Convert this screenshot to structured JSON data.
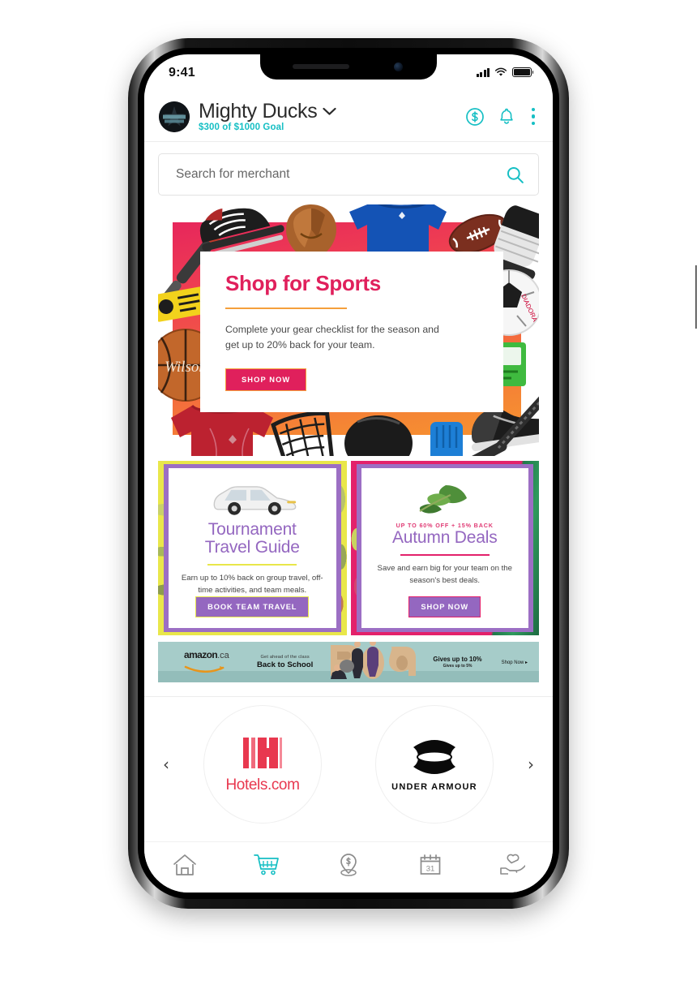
{
  "status_bar": {
    "time": "9:41",
    "signal_icon": "cellular-signal-icon",
    "wifi_icon": "wifi-icon",
    "battery_icon": "battery-icon"
  },
  "header": {
    "avatar_name": "team-logo-avatar",
    "team_name": "Mighty Ducks",
    "dropdown_icon": "chevron-down-icon",
    "goal_text": "$300 of $1000 Goal",
    "actions": [
      {
        "name": "dollar-circle-icon",
        "label": "Earnings"
      },
      {
        "name": "bell-icon",
        "label": "Notifications"
      },
      {
        "name": "kebab-menu-icon",
        "label": "More"
      }
    ],
    "accent_color": "#16bfc4"
  },
  "search": {
    "placeholder": "Search for merchant",
    "value": "",
    "icon": "search-icon",
    "icon_color": "#16bfc4"
  },
  "hero": {
    "title": "Shop for Sports",
    "subtitle": "Complete your gear checklist for the season and get up to 20% back for your team.",
    "cta_label": "SHOP NOW",
    "title_color": "#e0205c",
    "rule_color": "#f5a03c",
    "cta_bg": "#e0205c",
    "cta_border": "#f5a03c",
    "bg_gradient_from": "#e5205f",
    "bg_gradient_to": "#f79a2e"
  },
  "promos": [
    {
      "name": "tournament-travel-guide",
      "kicker": "",
      "title_line1": "Tournament",
      "title_line2": "Travel Guide",
      "subtitle": "Earn up to 10% back on group travel, off-time activities, and team meals.",
      "cta_label": "BOOK TEAM TRAVEL",
      "image": "minivan-illustration",
      "frame_color": "#9c6fc4",
      "outer_color": "#e9e74a",
      "title_color": "#9467c0",
      "rule_color": "#e9e74a"
    },
    {
      "name": "autumn-deals",
      "kicker": "UP TO 60% OFF + 15% BACK",
      "title_line1": "Autumn Deals",
      "title_line2": "",
      "subtitle": "Save and earn big for your team on the season's best deals.",
      "cta_label": "SHOP NOW",
      "image": "leaf-illustration",
      "frame_color": "#9c6fc4",
      "outer_color": "#e3216b",
      "title_color": "#9467c0",
      "rule_color": "#e3216b"
    }
  ],
  "amazon_ad": {
    "brand_word": "amazon",
    "brand_tld": ".ca",
    "kicker": "Get ahead of the class",
    "headline": "Back to School",
    "offer_main": "Gives up to 10%",
    "offer_sub": "Gives up to 5%",
    "shop_now": "Shop Now ▸",
    "background_color": "#a6ccc9"
  },
  "carousel": {
    "prev_icon": "chevron-left-icon",
    "next_icon": "chevron-right-icon",
    "merchants": [
      {
        "name": "merchant-hotels-com",
        "label": "Hotels.com",
        "logo": "hotels-com-logo",
        "color": "#e8384f"
      },
      {
        "name": "merchant-under-armour",
        "label": "UNDER ARMOUR",
        "logo": "under-armour-logo",
        "color": "#0a0a0a"
      }
    ]
  },
  "bottom_nav": {
    "active_index": 1,
    "active_color": "#16bfc4",
    "inactive_color": "#8c8c8c",
    "items": [
      {
        "name": "nav-home",
        "icon": "home-icon",
        "label": "Home"
      },
      {
        "name": "nav-shop",
        "icon": "shopping-cart-icon",
        "label": "Shop"
      },
      {
        "name": "nav-local",
        "icon": "location-pin-dollar-icon",
        "label": "Local"
      },
      {
        "name": "nav-calendar",
        "icon": "calendar-31-icon",
        "label": "Calendar"
      },
      {
        "name": "nav-giving",
        "icon": "heart-in-hand-icon",
        "label": "Giving"
      }
    ]
  }
}
